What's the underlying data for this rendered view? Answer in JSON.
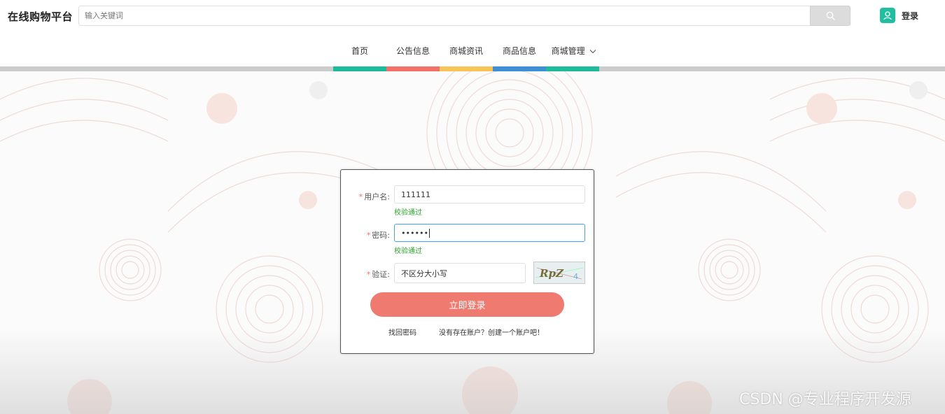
{
  "header": {
    "brand": "在线购物平台",
    "search_placeholder": "输入关键词",
    "login_label": "登录"
  },
  "nav": {
    "items": [
      {
        "label": "首页",
        "color": "#1dba9b"
      },
      {
        "label": "公告信息",
        "color": "#f07268"
      },
      {
        "label": "商城资讯",
        "color": "#f8c458"
      },
      {
        "label": "商品信息",
        "color": "#3d8fd8"
      },
      {
        "label": "商城管理",
        "color": "#1dba9b"
      }
    ]
  },
  "login": {
    "username_label": "用户名:",
    "username_value": "111111",
    "username_status": "校验通过",
    "password_label": "密码:",
    "password_value": "••••••",
    "password_status": "校验通过",
    "verify_label": "验证:",
    "verify_placeholder": "不区分大小写",
    "captcha_text": "RpZ",
    "submit_label": "立即登录",
    "forgot_label": "找回密码",
    "register_label": "没有存在账户？创建一个账户吧！"
  },
  "watermark": "CSDN @专业程序开发源",
  "colors": {
    "accent": "#ef7a70",
    "success": "#2ea52e",
    "brand_green": "#1fbf9f"
  }
}
